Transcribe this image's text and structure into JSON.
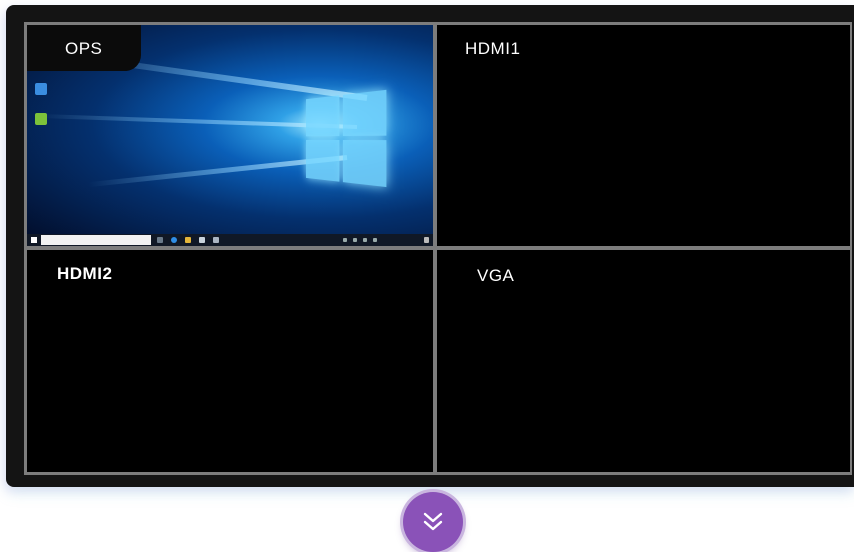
{
  "panes": {
    "top_left": {
      "label": "OPS"
    },
    "top_right": {
      "label": "HDMI1"
    },
    "bottom_left": {
      "label": "HDMI2"
    },
    "bottom_right": {
      "label": "VGA"
    }
  },
  "icons": {
    "scroll_down": "double-chevron-down-icon"
  },
  "colors": {
    "accent": "#8a52b8",
    "pane_background": "#000000",
    "grid_divider": "#7d7d7d",
    "bezel": "#141414"
  }
}
